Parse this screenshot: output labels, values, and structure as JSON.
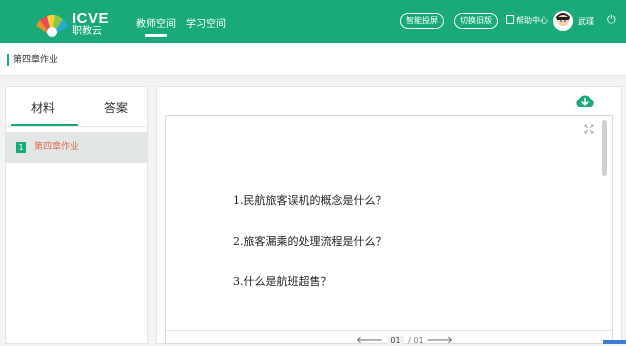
{
  "header": {
    "logo_line1": "ICVE",
    "logo_line2": "职教云",
    "nav": [
      {
        "label": "教师空间",
        "active": true
      },
      {
        "label": "学习空间",
        "active": false
      }
    ],
    "pill1": "智能投屏",
    "pill2": "切换旧版",
    "help": "帮助中心",
    "username": "武瑾"
  },
  "breadcrumb": "第四章作业",
  "tabs": [
    "材料",
    "答案"
  ],
  "list": [
    {
      "num": "1",
      "label": "第四章作业"
    }
  ],
  "questions": [
    "1.民航旅客误机的概念是什么？",
    "2.旅客漏乘的处理流程是什么？",
    "3.什么是航班超售？"
  ],
  "pager": {
    "current": "01",
    "total": "/ 01"
  },
  "colors": {
    "primary": "#19a97b",
    "active_item_text": "#e36a52"
  },
  "icons": [
    "logo-icon",
    "help-icon",
    "avatar",
    "power-icon",
    "download-icon",
    "expand-icon",
    "prev-arrow-icon",
    "next-arrow-icon"
  ]
}
